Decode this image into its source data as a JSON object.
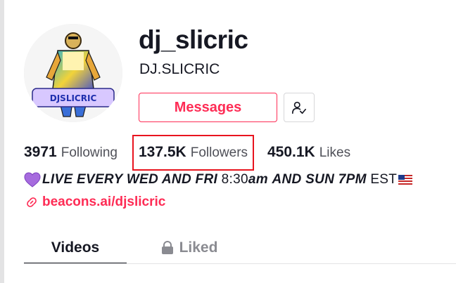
{
  "profile": {
    "username": "dj_slicric",
    "nickname": "DJ.SLICRIC",
    "avatar_text": "DJSLICRIC"
  },
  "actions": {
    "messages_label": "Messages",
    "follow_icon": "user-check-icon"
  },
  "stats": {
    "following": {
      "count": "3971",
      "label": "Following"
    },
    "followers": {
      "count": "137.5K",
      "label": "Followers"
    },
    "likes": {
      "count": "450.1K",
      "label": "Likes"
    }
  },
  "bio": {
    "text_bold": "LIVE EVERY WED AND FRI",
    "time1": "8:30",
    "am": "am",
    "text_mid": "AND SUN 7PM",
    "tz": "EST",
    "heart_icon": "purple-heart-icon",
    "flag_icon": "us-flag-icon"
  },
  "link": {
    "icon": "link-icon",
    "text": "beacons.ai/djslicric"
  },
  "tabs": [
    {
      "label": "Videos",
      "active": true
    },
    {
      "label": "Liked",
      "active": false,
      "icon": "lock-icon"
    }
  ],
  "colors": {
    "accent": "#fe2c55",
    "text": "#161823",
    "muted": "#4f5058",
    "highlight": "#e8141e"
  }
}
